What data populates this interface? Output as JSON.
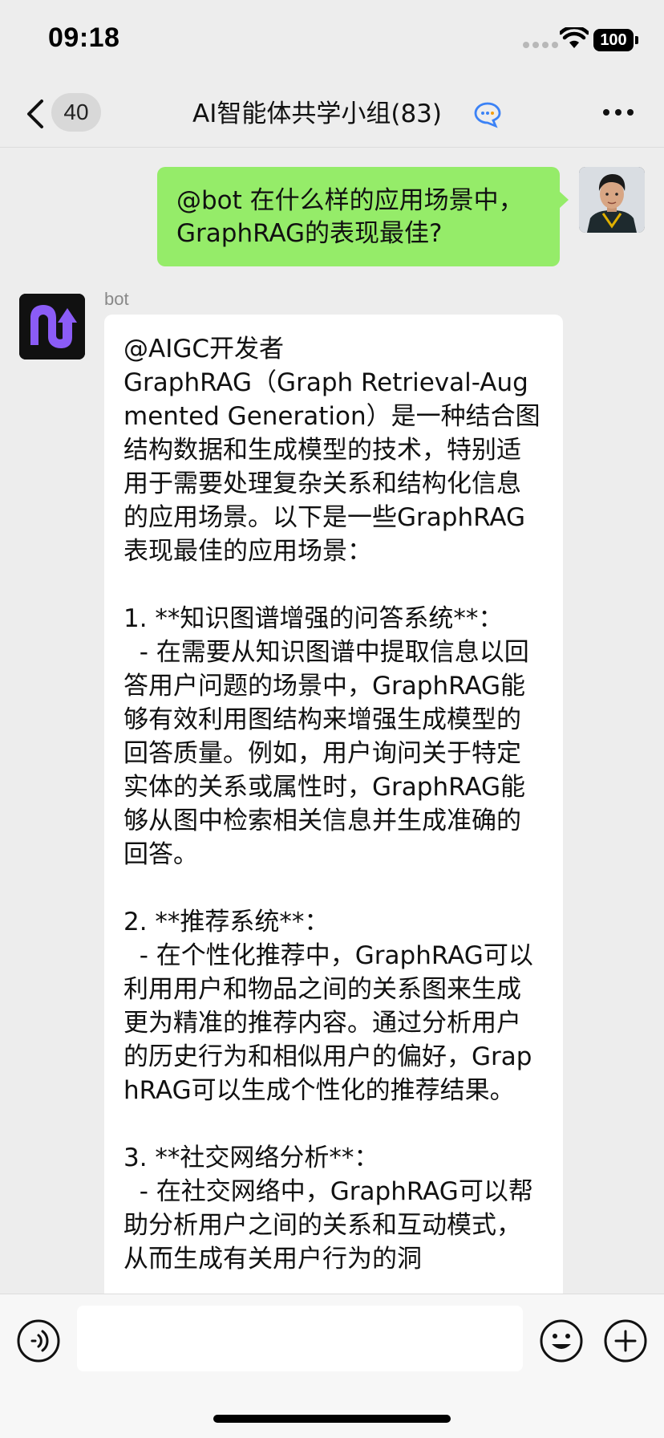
{
  "status_bar": {
    "time": "09:18",
    "battery": "100"
  },
  "header": {
    "unread_count": "40",
    "title": "AI智能体共学小组(83)",
    "icons": {
      "back": "chevron-left-icon",
      "group_chat": "chat-bubble-icon",
      "more": "more-dots-icon"
    }
  },
  "messages": [
    {
      "direction": "outgoing",
      "text": "@bot 在什么样的应用场景中，GraphRAG的表现最佳?"
    },
    {
      "direction": "incoming",
      "sender": "bot",
      "text": "@AIGC开发者\nGraphRAG（Graph Retrieval-Augmented Generation）是一种结合图结构数据和生成模型的技术，特别适用于需要处理复杂关系和结构化信息的应用场景。以下是一些GraphRAG表现最佳的应用场景：\n\n1. **知识图谱增强的问答系统**：\n  - 在需要从知识图谱中提取信息以回答用户问题的场景中，GraphRAG能够有效利用图结构来增强生成模型的回答质量。例如，用户询问关于特定实体的关系或属性时，GraphRAG能够从图中检索相关信息并生成准确的回答。\n\n2. **推荐系统**：\n  - 在个性化推荐中，GraphRAG可以利用用户和物品之间的关系图来生成更为精准的推荐内容。通过分析用户的历史行为和相似用户的偏好，GraphRAG可以生成个性化的推荐结果。\n\n3. **社交网络分析**：\n  - 在社交网络中，GraphRAG可以帮助分析用户之间的关系和互动模式，从而生成有关用户行为的洞"
    }
  ],
  "input_bar": {
    "value": "",
    "icons": {
      "voice": "voice-icon",
      "emoji": "emoji-icon",
      "plus": "plus-icon"
    }
  },
  "colors": {
    "background": "#ededed",
    "outgoing_bubble": "#95ec69",
    "incoming_bubble": "#ffffff",
    "bot_logo": "#8b5cf6"
  }
}
